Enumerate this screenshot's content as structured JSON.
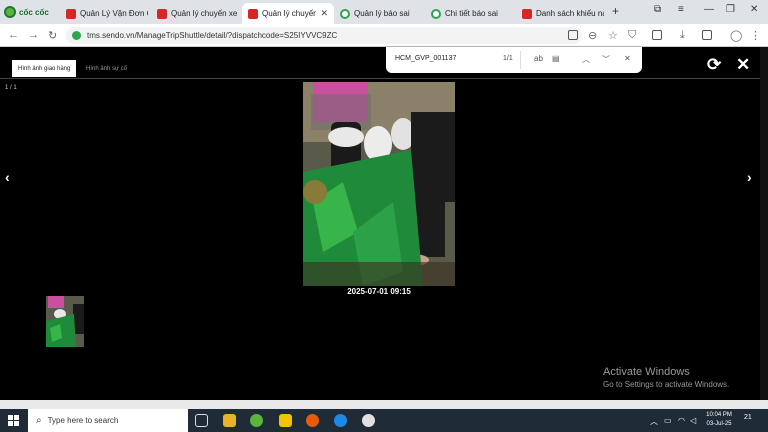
{
  "browser": {
    "brand": "cốc cốc",
    "tabs": [
      {
        "label": "Quản Lý Vận Đơn Or",
        "favicon": "red"
      },
      {
        "label": "Quản lý chuyến xe",
        "favicon": "red"
      },
      {
        "label": "Quản lý chuyến",
        "favicon": "red",
        "active": true,
        "close": "✕"
      },
      {
        "label": "Quản lý báo sai",
        "favicon": "green"
      },
      {
        "label": "Chi tiết báo sai",
        "favicon": "green"
      },
      {
        "label": "Danh sách khiếu nại",
        "favicon": "red"
      }
    ],
    "url": "tms.sendo.vn/ManageTripShuttle/detail/?dispatchcode=S25IYVVC9ZC"
  },
  "find_bar": {
    "query": "HCM_GVP_001137",
    "count": "1/1",
    "match_case_label": "ab"
  },
  "viewer": {
    "tabs": [
      "Hình ảnh giao hàng",
      "Hình ảnh sự cố"
    ],
    "counter": "1 / 1",
    "timestamp": "2025-07-01 09:15"
  },
  "watermark": {
    "title": "Activate Windows",
    "subtitle": "Go to Settings to activate Windows."
  },
  "taskbar": {
    "search_placeholder": "Type here to search",
    "time": "10:04 PM",
    "date": "03-Jul-25",
    "notifications": "21"
  },
  "colors": {
    "accent_red": "#d62626",
    "green": "#2ea44f",
    "taskbar": "#1f2b37"
  }
}
